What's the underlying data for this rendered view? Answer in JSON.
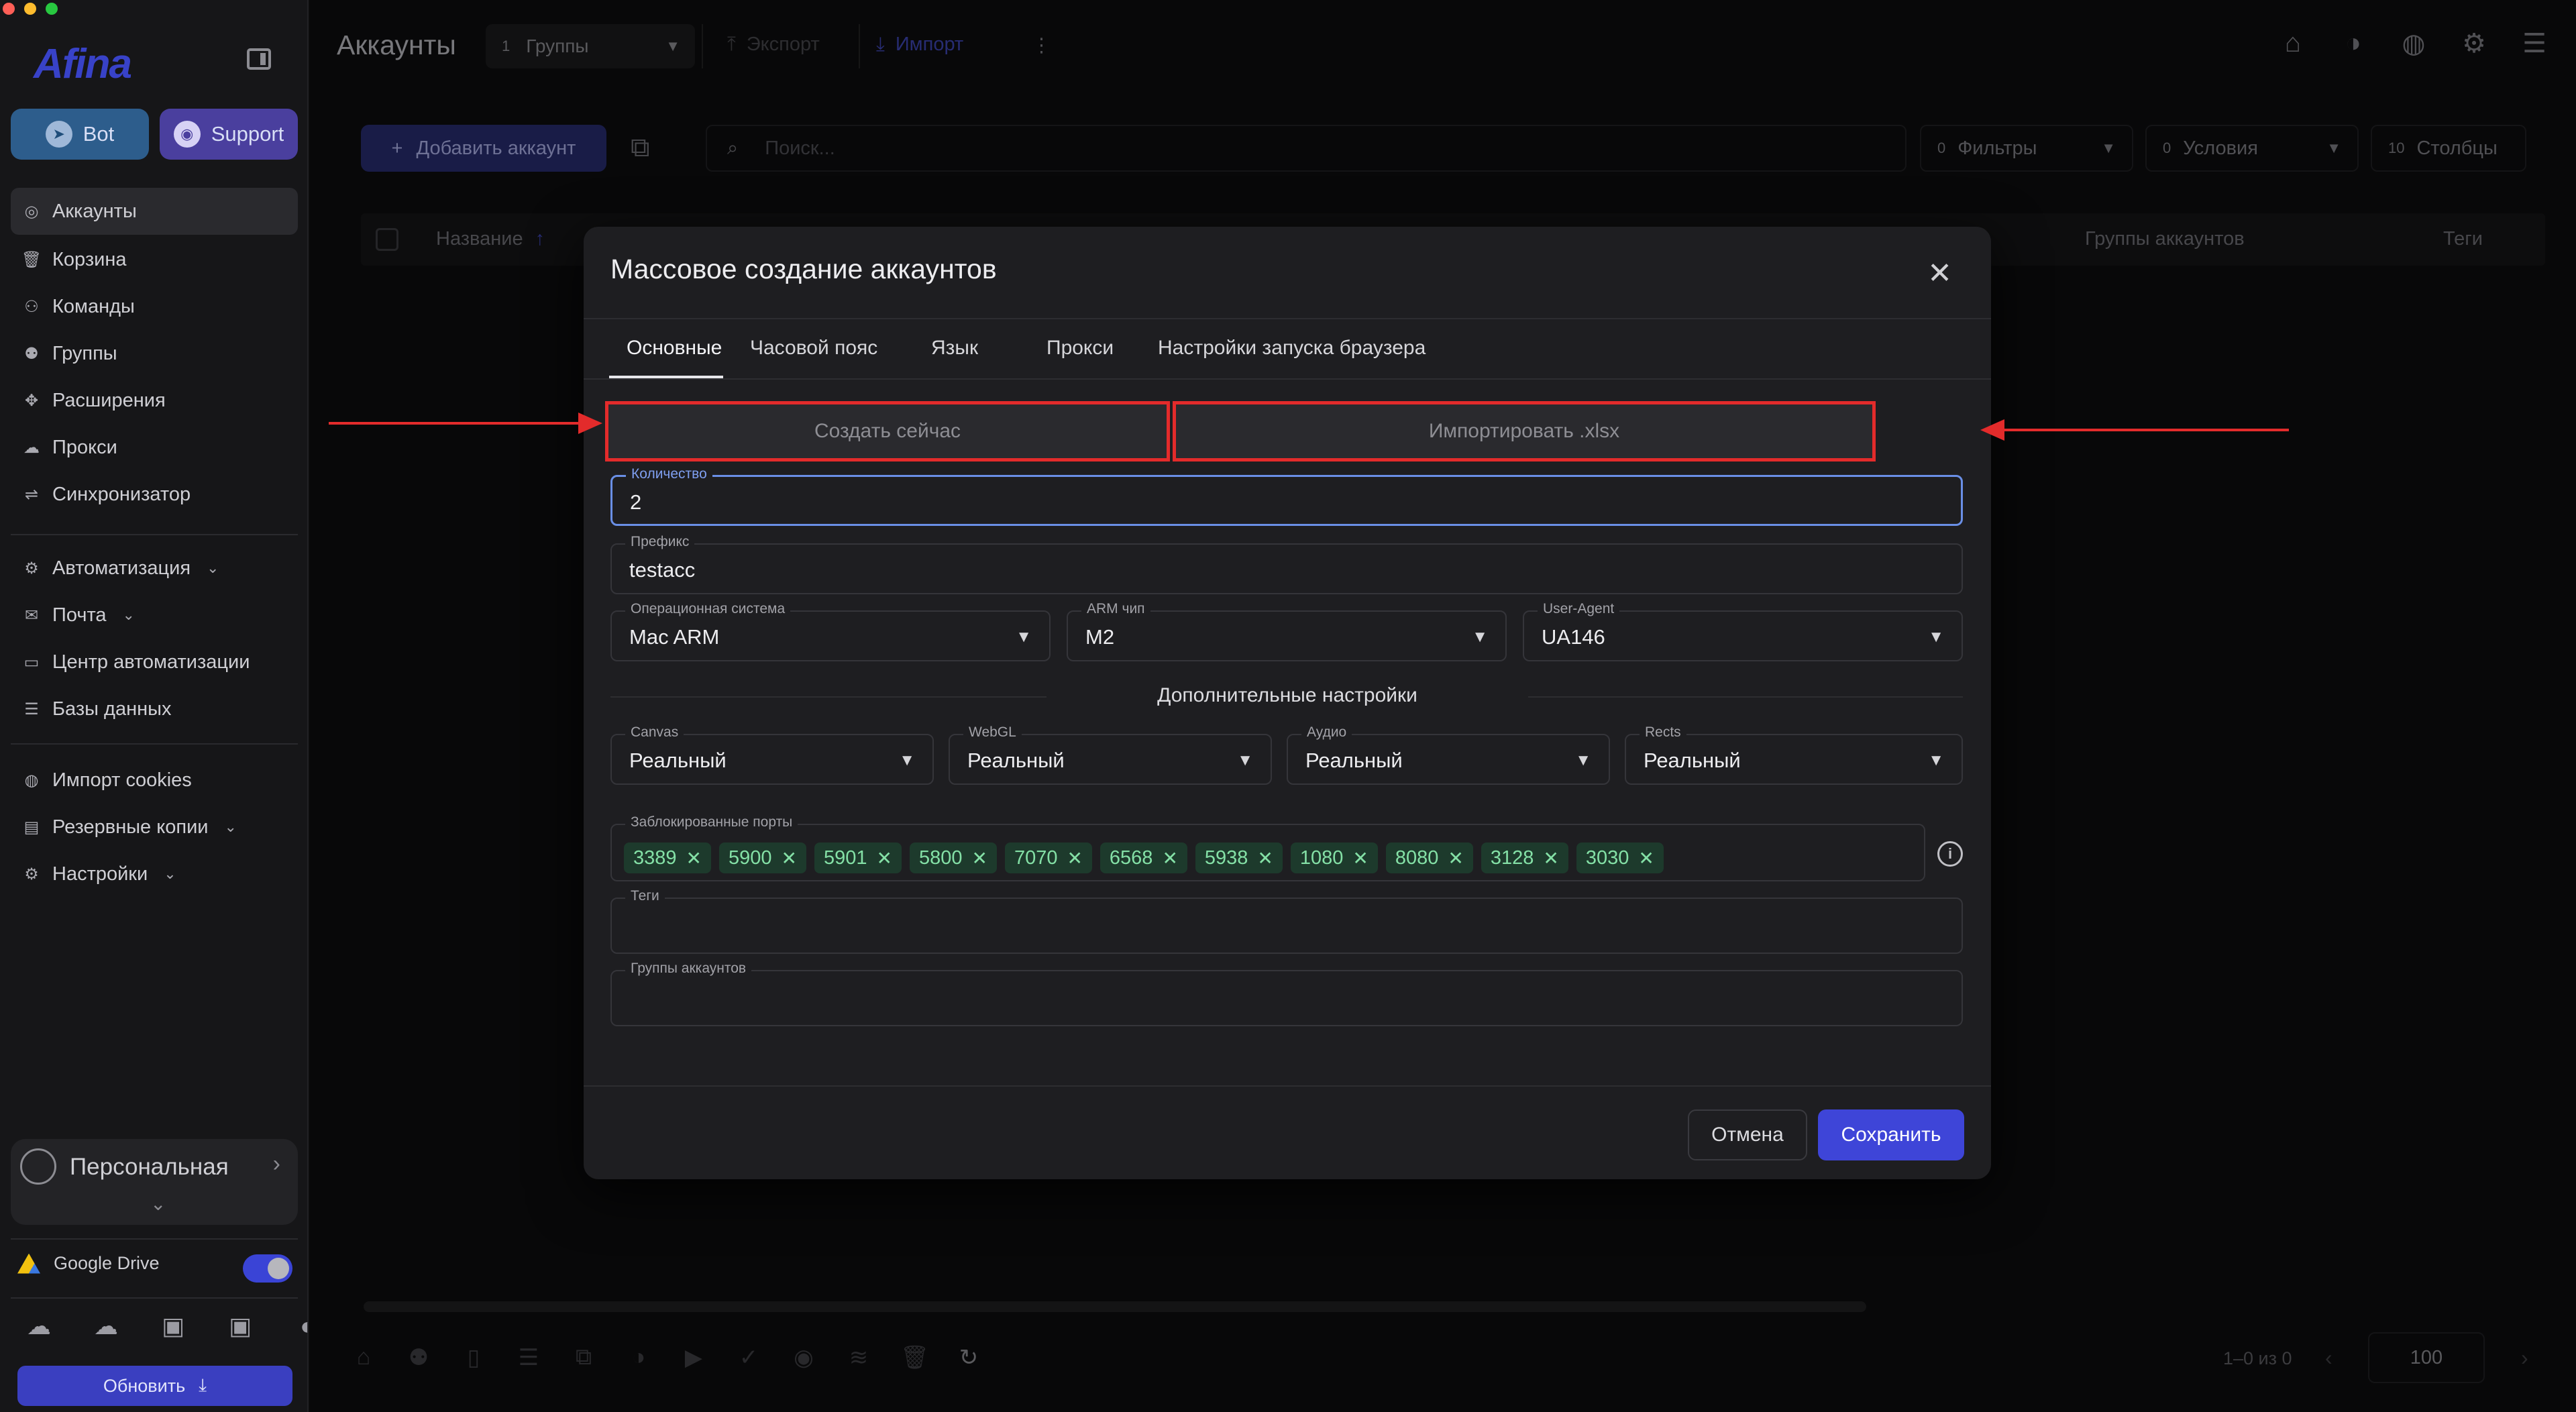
{
  "sidebar": {
    "logo": "Afina",
    "bot_label": "Bot",
    "support_label": "Support",
    "items": [
      {
        "label": "Аккаунты",
        "icon": "user-circle-icon"
      },
      {
        "label": "Корзина",
        "icon": "trash-icon"
      },
      {
        "label": "Команды",
        "icon": "team-icon"
      },
      {
        "label": "Группы",
        "icon": "people-icon"
      },
      {
        "label": "Расширения",
        "icon": "puzzle-icon"
      },
      {
        "label": "Прокси",
        "icon": "cloud-icon"
      },
      {
        "label": "Синхронизатор",
        "icon": "sync-icon"
      },
      {
        "label": "Автоматизация",
        "icon": "robot-icon"
      },
      {
        "label": "Почта",
        "icon": "mail-icon"
      },
      {
        "label": "Центр автоматизации",
        "icon": "monitor-icon"
      },
      {
        "label": "Базы данных",
        "icon": "database-icon"
      },
      {
        "label": "Импорт cookies",
        "icon": "cookie-icon"
      },
      {
        "label": "Резервные копии",
        "icon": "backup-icon"
      },
      {
        "label": "Настройки",
        "icon": "gear-icon"
      }
    ],
    "workspace_label": "Персональная",
    "google_drive_label": "Google Drive",
    "update_label": "Обновить"
  },
  "header": {
    "title": "Аккаунты",
    "group_count": "1",
    "group_label": "Группы",
    "export_label": "Экспорт",
    "import_label": "Импорт"
  },
  "toolbar": {
    "add_account_label": "Добавить аккаунт",
    "search_placeholder": "Поиск...",
    "filters_count": "0",
    "filters_label": "Фильтры",
    "conditions_count": "0",
    "conditions_label": "Условия",
    "columns_count": "10",
    "columns_label": "Столбцы"
  },
  "table": {
    "col_name": "Название",
    "sort_indicator": "↑",
    "col_account_groups": "Группы аккаунтов",
    "col_tags": "Теги"
  },
  "pagination": {
    "range": "1–0 из 0",
    "rows_per_page": "100"
  },
  "modal": {
    "title": "Массовое создание аккаунтов",
    "tabs": [
      "Основные",
      "Часовой пояс",
      "Язык",
      "Прокси",
      "Настройки запуска браузера"
    ],
    "create_now_label": "Создать сейчас",
    "import_xlsx_label": "Импортировать .xlsx",
    "quantity_label": "Количество",
    "quantity_value": "2",
    "prefix_label": "Префикс",
    "prefix_value": "testacc",
    "os_label": "Операционная система",
    "os_value": "Mac ARM",
    "arm_label": "ARM чип",
    "arm_value": "M2",
    "ua_label": "User-Agent",
    "ua_value": "UA146",
    "extra_settings_title": "Дополнительные настройки",
    "canvas_label": "Canvas",
    "canvas_value": "Реальный",
    "webgl_label": "WebGL",
    "webgl_value": "Реальный",
    "audio_label": "Аудио",
    "audio_value": "Реальный",
    "rects_label": "Rects",
    "rects_value": "Реальный",
    "blocked_ports_label": "Заблокированные порты",
    "blocked_ports": [
      "3389",
      "5900",
      "5901",
      "5800",
      "7070",
      "6568",
      "5938",
      "1080",
      "8080",
      "3128",
      "3030"
    ],
    "tags_label": "Теги",
    "account_groups_label": "Группы аккаунтов",
    "cancel_label": "Отмена",
    "save_label": "Сохранить"
  },
  "colors": {
    "accent": "#3e45d8",
    "annotation": "#e32b2b",
    "chip_text": "#84e0a6"
  }
}
